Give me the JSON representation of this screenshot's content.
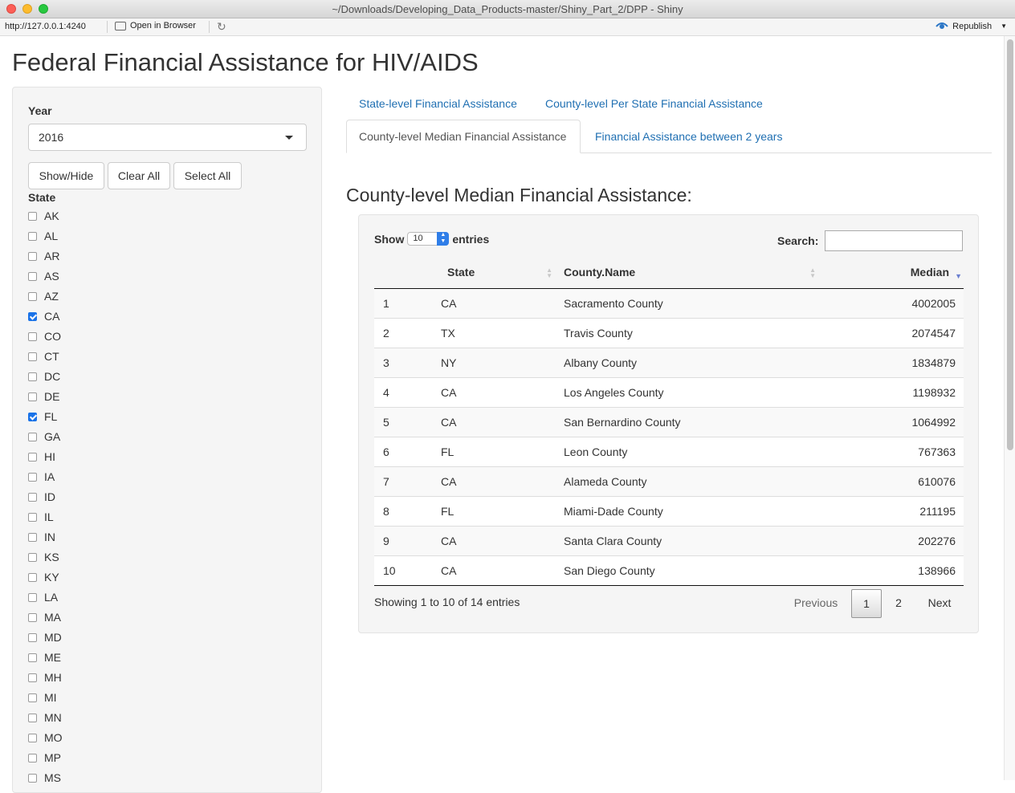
{
  "window": {
    "title": "~/Downloads/Developing_Data_Products-master/Shiny_Part_2/DPP - Shiny"
  },
  "toolbar": {
    "url": "http://127.0.0.1:4240",
    "open_in_browser": "Open in Browser",
    "republish": "Republish"
  },
  "app": {
    "title": "Federal Financial Assistance for HIV/AIDS"
  },
  "sidebar": {
    "year_label": "Year",
    "year_value": "2016",
    "buttons": {
      "show_hide": "Show/Hide",
      "clear_all": "Clear All",
      "select_all": "Select All"
    },
    "state_label": "State",
    "states": [
      {
        "code": "AK",
        "checked": false
      },
      {
        "code": "AL",
        "checked": false
      },
      {
        "code": "AR",
        "checked": false
      },
      {
        "code": "AS",
        "checked": false
      },
      {
        "code": "AZ",
        "checked": false
      },
      {
        "code": "CA",
        "checked": true
      },
      {
        "code": "CO",
        "checked": false
      },
      {
        "code": "CT",
        "checked": false
      },
      {
        "code": "DC",
        "checked": false
      },
      {
        "code": "DE",
        "checked": false
      },
      {
        "code": "FL",
        "checked": true
      },
      {
        "code": "GA",
        "checked": false
      },
      {
        "code": "HI",
        "checked": false
      },
      {
        "code": "IA",
        "checked": false
      },
      {
        "code": "ID",
        "checked": false
      },
      {
        "code": "IL",
        "checked": false
      },
      {
        "code": "IN",
        "checked": false
      },
      {
        "code": "KS",
        "checked": false
      },
      {
        "code": "KY",
        "checked": false
      },
      {
        "code": "LA",
        "checked": false
      },
      {
        "code": "MA",
        "checked": false
      },
      {
        "code": "MD",
        "checked": false
      },
      {
        "code": "ME",
        "checked": false
      },
      {
        "code": "MH",
        "checked": false
      },
      {
        "code": "MI",
        "checked": false
      },
      {
        "code": "MN",
        "checked": false
      },
      {
        "code": "MO",
        "checked": false
      },
      {
        "code": "MP",
        "checked": false
      },
      {
        "code": "MS",
        "checked": false
      }
    ]
  },
  "tabs": {
    "state_level": "State-level Financial Assistance",
    "county_per_state": "County-level Per State Financial Assistance",
    "county_median": "County-level Median Financial Assistance",
    "between_years": "Financial Assistance between 2 years"
  },
  "main": {
    "section_title": "County-level Median Financial Assistance:",
    "show_label": "Show",
    "entries_label": "entries",
    "page_length": "10",
    "search_label": "Search:",
    "columns": [
      "",
      "State",
      "County.Name",
      "Median"
    ],
    "rows": [
      [
        "1",
        "CA",
        "Sacramento County",
        "4002005"
      ],
      [
        "2",
        "TX",
        "Travis County",
        "2074547"
      ],
      [
        "3",
        "NY",
        "Albany County",
        "1834879"
      ],
      [
        "4",
        "CA",
        "Los Angeles County",
        "1198932"
      ],
      [
        "5",
        "CA",
        "San Bernardino County",
        "1064992"
      ],
      [
        "6",
        "FL",
        "Leon County",
        "767363"
      ],
      [
        "7",
        "CA",
        "Alameda County",
        "610076"
      ],
      [
        "8",
        "FL",
        "Miami-Dade County",
        "211195"
      ],
      [
        "9",
        "CA",
        "Santa Clara County",
        "202276"
      ],
      [
        "10",
        "CA",
        "San Diego County",
        "138966"
      ]
    ],
    "info": "Showing 1 to 10 of 14 entries",
    "pager": {
      "previous": "Previous",
      "current": "1",
      "page2": "2",
      "next": "Next"
    }
  }
}
